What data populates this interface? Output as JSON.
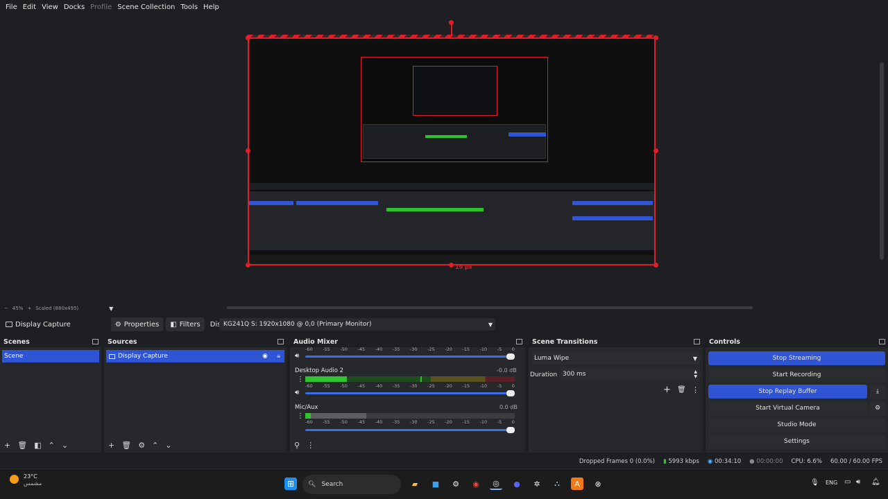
{
  "menu": [
    "File",
    "Edit",
    "View",
    "Docks",
    "Profile",
    "Scene Collection",
    "Tools",
    "Help"
  ],
  "menu_disabled": [
    "Profile"
  ],
  "preview": {
    "zoom_text": "45%",
    "scaled_text": "Scaled (880x495)",
    "distance_label": "19 px"
  },
  "context": {
    "source_name": "Display Capture",
    "properties": "Properties",
    "filters": "Filters",
    "display_label": "Display",
    "display_value": "KG241Q S: 1920x1080 @ 0,0 (Primary Monitor)"
  },
  "scenes": {
    "title": "Scenes",
    "items": [
      "Scene"
    ]
  },
  "sources": {
    "title": "Sources",
    "items": [
      "Display Capture"
    ]
  },
  "audio_mixer": {
    "title": "Audio Mixer",
    "scale_ticks": [
      "-60",
      "-55",
      "-50",
      "-45",
      "-40",
      "-35",
      "-30",
      "-25",
      "-20",
      "-15",
      "-10",
      "-5",
      "0"
    ],
    "channels": [
      {
        "name": "Desktop Audio 2",
        "db": "-0.0 dB",
        "level": 0.2
      },
      {
        "name": "Mic/Aux",
        "db": "0.0 dB",
        "level": 0.05
      }
    ]
  },
  "scene_transitions": {
    "title": "Scene Transitions",
    "transition": "Luma Wipe",
    "duration_label": "Duration",
    "duration_value": "300 ms"
  },
  "controls": {
    "title": "Controls",
    "buttons": [
      "Stop Streaming",
      "Start Recording",
      "Stop Replay Buffer",
      "Start Virtual Camera",
      "Studio Mode",
      "Settings"
    ]
  },
  "status": {
    "dropped": "Dropped Frames 0 (0.0%)",
    "bitrate": "5993 kbps",
    "stream_time": "00:34:10",
    "rec_time": "00:00:00",
    "cpu": "CPU: 6.6%",
    "fps": "60.00 / 60.00 FPS"
  },
  "taskbar": {
    "weather_temp": "23°C",
    "weather_desc": "مشمس",
    "search": "Search",
    "lang": "ENG"
  },
  "colors": {
    "accent": "#2f55d4",
    "selection_red": "#e11d2a",
    "meter_green": "#2ec42e"
  }
}
